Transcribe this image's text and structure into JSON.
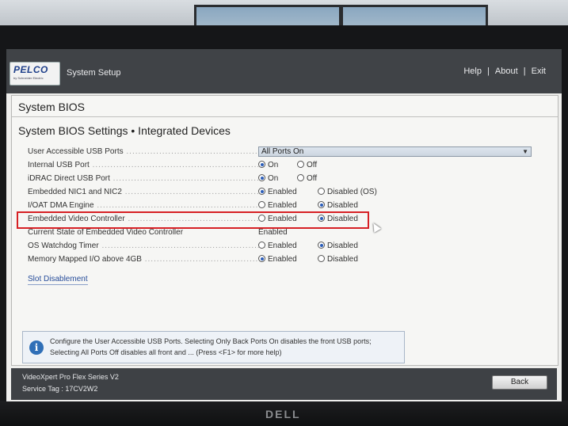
{
  "header": {
    "logo_text": "PELCO",
    "logo_subtext": "by Schneider Electric",
    "app_title": "System Setup",
    "links": [
      "Help",
      "About",
      "Exit"
    ],
    "link_separator": "|"
  },
  "section": {
    "title": "System BIOS",
    "subtitle": "System BIOS Settings • Integrated Devices"
  },
  "settings": [
    {
      "label": "User Accessible USB Ports",
      "type": "dropdown",
      "value": "All Ports On"
    },
    {
      "label": "Internal USB Port",
      "type": "radio",
      "options": [
        "On",
        "Off"
      ],
      "selected": 0
    },
    {
      "label": "iDRAC Direct USB Port",
      "type": "radio",
      "options": [
        "On",
        "Off"
      ],
      "selected": 0
    },
    {
      "label": "Embedded NIC1 and NIC2",
      "type": "radio",
      "options": [
        "Enabled",
        "Disabled (OS)"
      ],
      "selected": 0
    },
    {
      "label": "I/OAT DMA Engine",
      "type": "radio",
      "options": [
        "Enabled",
        "Disabled"
      ],
      "selected": 1
    },
    {
      "label": "Embedded Video Controller",
      "type": "radio",
      "options": [
        "Enabled",
        "Disabled"
      ],
      "selected": 1
    },
    {
      "label": "Current State of Embedded Video Controller",
      "type": "static",
      "value": "Enabled"
    },
    {
      "label": "OS Watchdog Timer",
      "type": "radio",
      "options": [
        "Enabled",
        "Disabled"
      ],
      "selected": 1
    },
    {
      "label": "Memory Mapped I/O above 4GB",
      "type": "radio",
      "options": [
        "Enabled",
        "Disabled"
      ],
      "selected": 0
    }
  ],
  "slot_link": "Slot Disablement",
  "help": {
    "text": "Configure the User Accessible USB Ports. Selecting Only Back Ports On disables the front USB ports; Selecting All Ports Off disables all front and ... (Press <F1> for more help)"
  },
  "footer": {
    "model": "VideoXpert Pro Flex Series V2",
    "service_tag": "Service Tag : 17CV2W2",
    "back_label": "Back"
  },
  "bezel": {
    "brand": "DELL"
  },
  "colors": {
    "accent": "#2b5db8",
    "highlight_border": "#d62024",
    "header_bg": "#404347"
  }
}
